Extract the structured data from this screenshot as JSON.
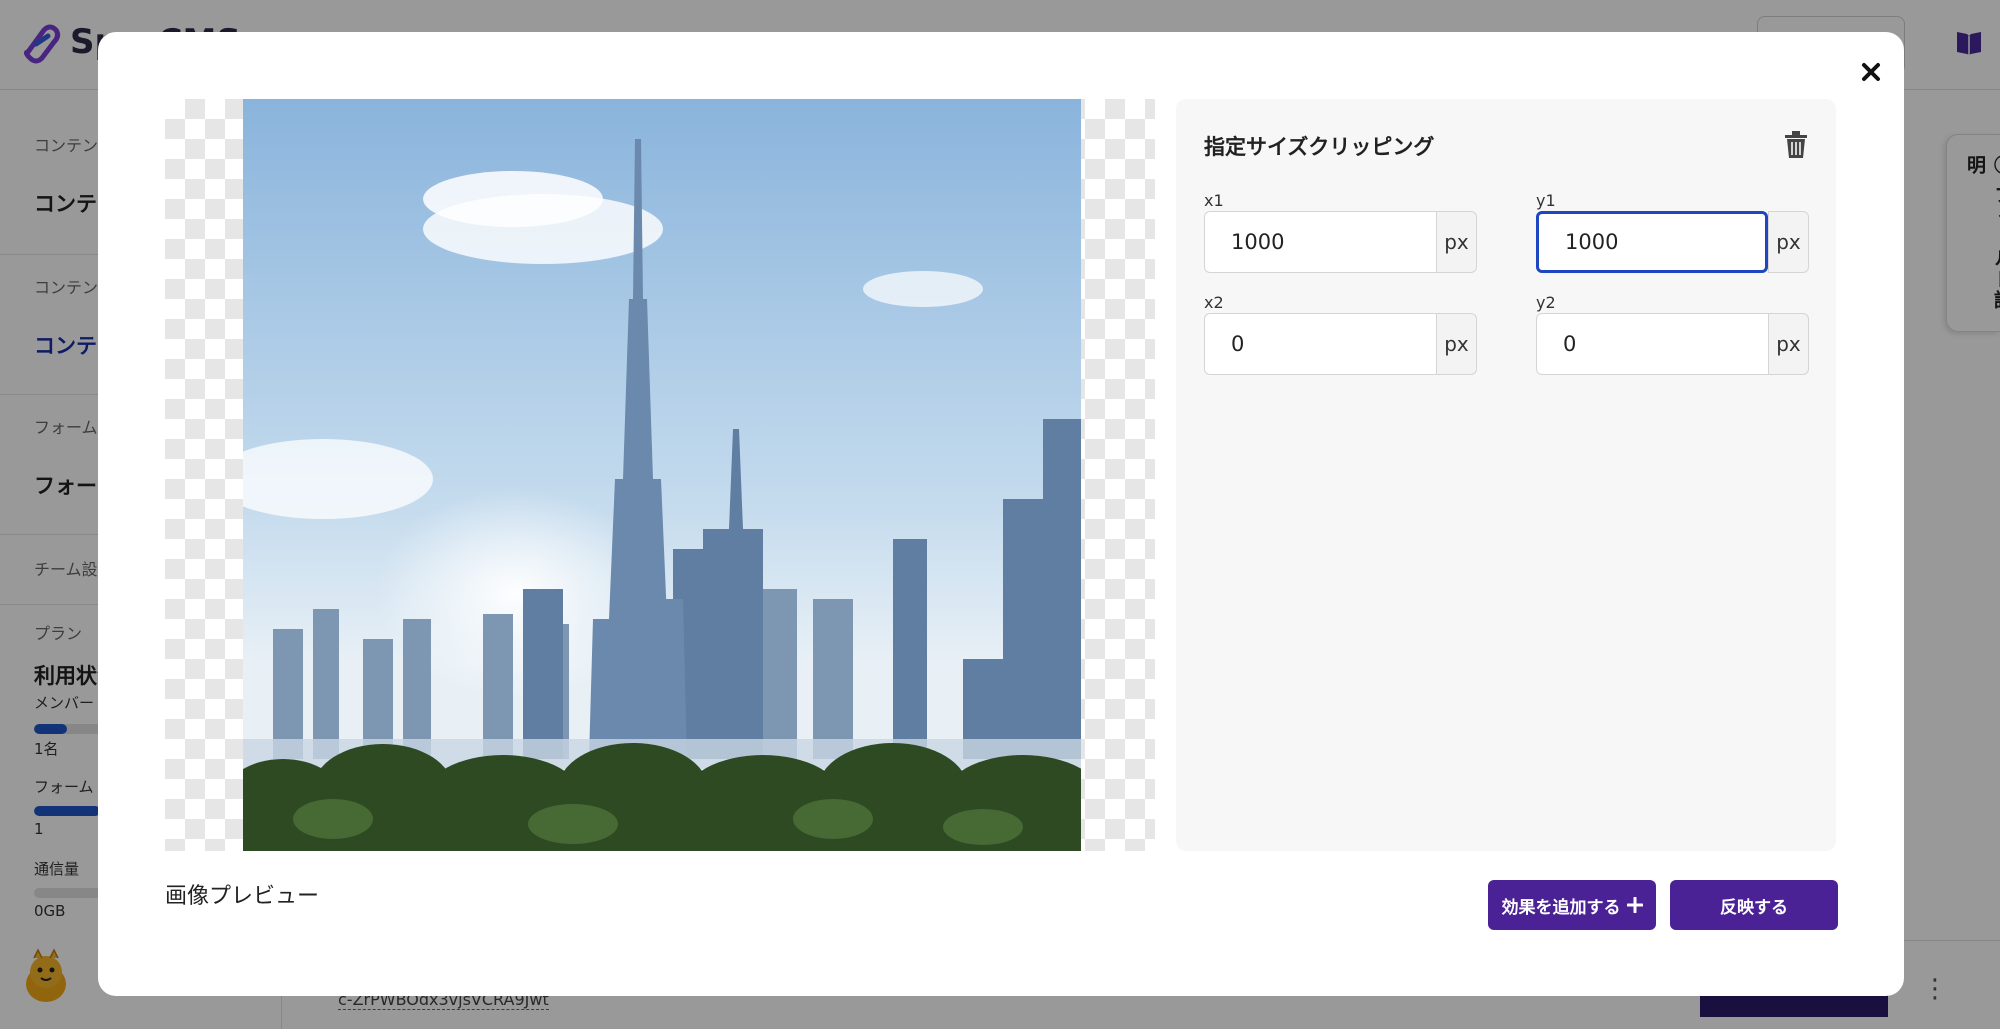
{
  "app": {
    "brand_name": "Sp...CMS",
    "sidebar": {
      "sec1": "コンテン",
      "item1": "コンテン",
      "sec2": "コンテン",
      "item2": "コンテン",
      "sec3": "フォーム",
      "item3": "フォー",
      "sec4": "チーム設",
      "sec5": "プラン",
      "usage_title": "利用状況",
      "member_label": "メンバー",
      "member_value": "1名",
      "member_fraction": 0.3,
      "form_label": "フォーム",
      "form_value": "1",
      "form_fraction": 0.6,
      "traffic_label": "通信量",
      "traffic_value": "0GB",
      "traffic_fraction": 0
    },
    "side_tab_label": "フィールド説明",
    "bottom_id": "c-ZrPWBOdx3vjsVCRA9Jwt"
  },
  "modal": {
    "preview_label": "画像プレビュー",
    "panel_title": "指定サイズクリッピング",
    "fields": {
      "x1": {
        "label": "x1",
        "value": "1000",
        "unit": "px"
      },
      "y1": {
        "label": "y1",
        "value": "1000",
        "unit": "px"
      },
      "x2": {
        "label": "x2",
        "value": "0",
        "unit": "px"
      },
      "y2": {
        "label": "y2",
        "value": "0",
        "unit": "px"
      }
    },
    "add_effect_label": "効果を追加する",
    "apply_label": "反映する"
  },
  "colors": {
    "accent": "#4a2296",
    "focus": "#1e46c0",
    "progress": "#2155c9"
  },
  "icons": {
    "close": "close-icon",
    "trash": "trash-icon",
    "plus": "plus-icon",
    "book": "book-icon",
    "info": "info-circle-icon"
  }
}
